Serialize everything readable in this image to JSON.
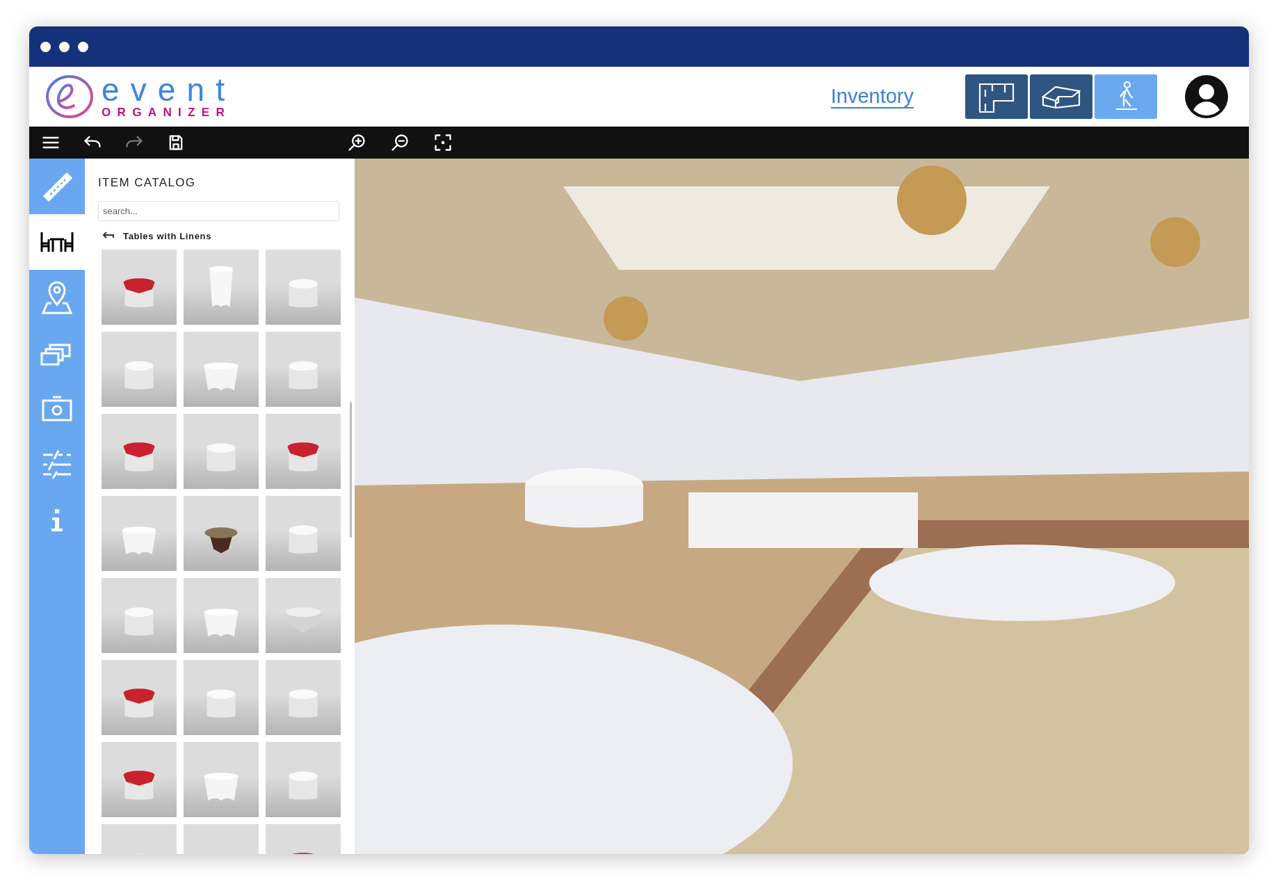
{
  "logo": {
    "title": "event",
    "subtitle": "ORGANIZER"
  },
  "header": {
    "link": "Inventory",
    "views": [
      {
        "kind": "floorplan",
        "selected": false
      },
      {
        "kind": "room3d",
        "selected": false
      },
      {
        "kind": "walk",
        "selected": true
      }
    ]
  },
  "toolbar": {
    "left": [
      {
        "kind": "menu",
        "disabled": false
      },
      {
        "kind": "undo",
        "disabled": false
      },
      {
        "kind": "redo",
        "disabled": true
      },
      {
        "kind": "save",
        "disabled": false
      }
    ],
    "center": [
      {
        "kind": "zoom-in",
        "disabled": false
      },
      {
        "kind": "zoom-out",
        "disabled": false
      },
      {
        "kind": "fit",
        "disabled": false
      }
    ]
  },
  "sidebar": {
    "items": [
      {
        "kind": "ruler",
        "selected": false
      },
      {
        "kind": "furniture",
        "selected": true
      },
      {
        "kind": "location",
        "selected": false
      },
      {
        "kind": "layers",
        "selected": false
      },
      {
        "kind": "camera",
        "selected": false
      },
      {
        "kind": "adjust",
        "selected": false
      },
      {
        "kind": "info",
        "selected": false
      }
    ]
  },
  "catalog": {
    "title": "ITEM CATALOG",
    "search": {
      "placeholder": "search..."
    },
    "category": "Tables with Linens"
  }
}
